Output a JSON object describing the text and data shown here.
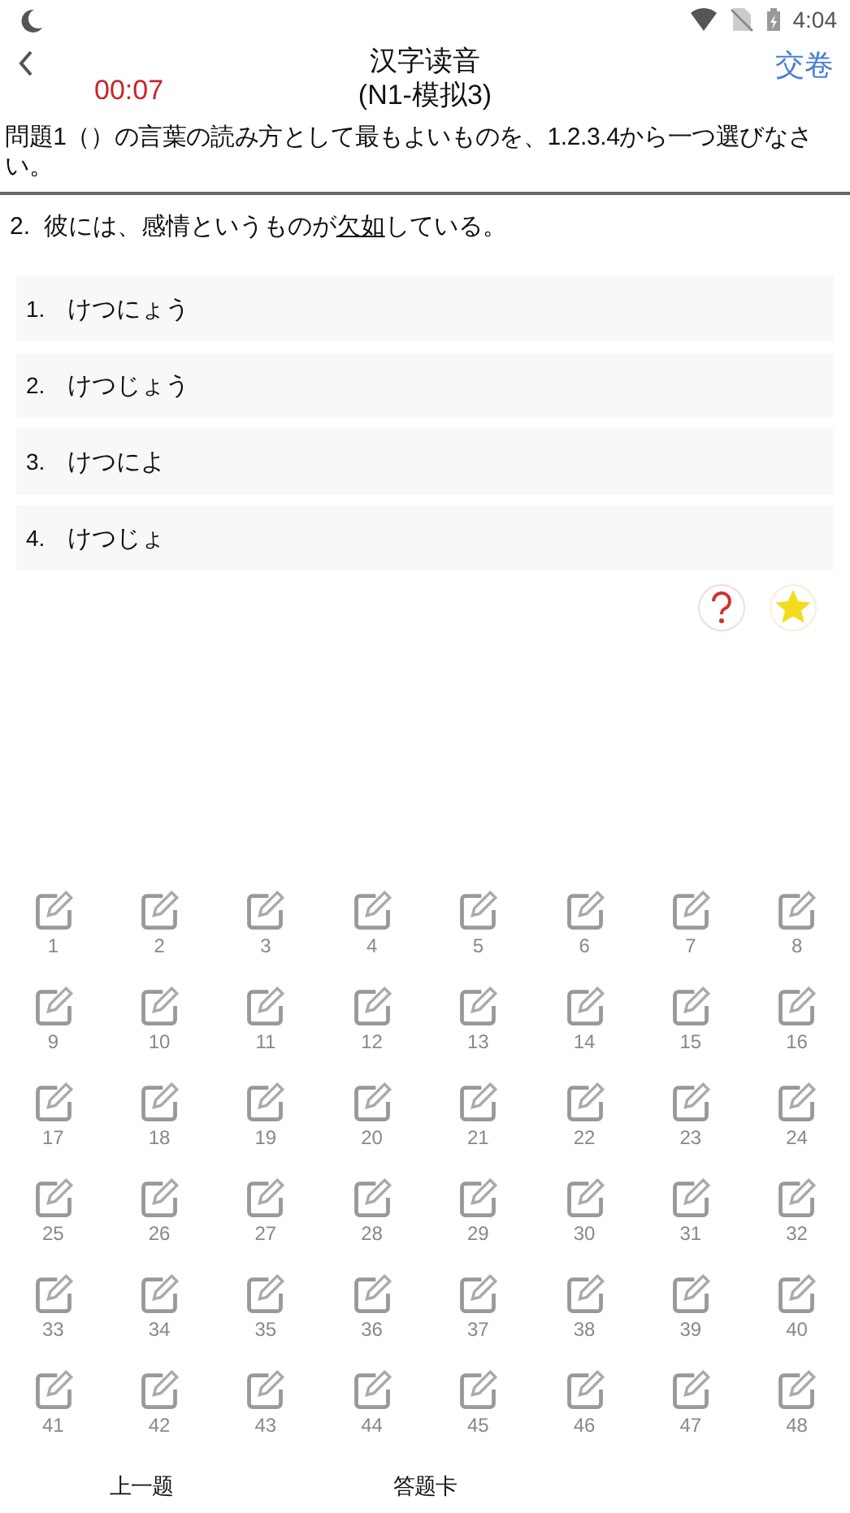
{
  "status_bar": {
    "time": "4:04"
  },
  "header": {
    "title": "汉字读音",
    "subtitle": "(N1-模拟3)",
    "timer": "00:07",
    "submit": "交卷"
  },
  "instruction": "問題1（）の言葉の読み方として最もよいものを、1.2.3.4から一つ選びなさい。",
  "question": {
    "number": "2.",
    "text_before": "彼には、感情というものが",
    "underlined": "欠如",
    "text_after": "している。"
  },
  "options": [
    {
      "number": "1.",
      "text": "けつにょう"
    },
    {
      "number": "2.",
      "text": "けつじょう"
    },
    {
      "number": "3.",
      "text": "けつによ"
    },
    {
      "number": "4.",
      "text": "けつじょ"
    }
  ],
  "answer_sheet": [
    "1",
    "2",
    "3",
    "4",
    "5",
    "6",
    "7",
    "8",
    "9",
    "10",
    "11",
    "12",
    "13",
    "14",
    "15",
    "16",
    "17",
    "18",
    "19",
    "20",
    "21",
    "22",
    "23",
    "24",
    "25",
    "26",
    "27",
    "28",
    "29",
    "30",
    "31",
    "32",
    "33",
    "34",
    "35",
    "36",
    "37",
    "38",
    "39",
    "40",
    "41",
    "42",
    "43",
    "44",
    "45",
    "46",
    "47",
    "48"
  ],
  "bottom_bar": [
    "上一题",
    "答题卡"
  ]
}
